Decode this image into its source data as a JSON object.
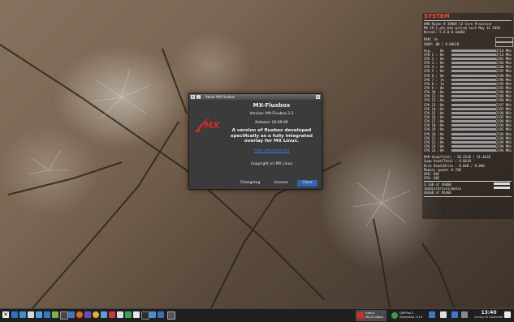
{
  "conky": {
    "title": "SYSTEM",
    "processor": "AMD Ryzen 9 3900X 12-Core Processor",
    "kernel_line": "MX-19.2_ahs_kde-gitlab test May 31 2020",
    "kernel": "Kernel: 5.6.0-0-amd64",
    "ram": "RAM:  1%",
    "swap": "SWAP:   0B  /  0.00GiB",
    "cpus": [
      {
        "label": "Avg.",
        "pct": "0%",
        "freq": "3716 MHz"
      },
      {
        "label": "CPU 1 :",
        "pct": "0%",
        "freq": "3716 MHz"
      },
      {
        "label": "CPU 2 :",
        "pct": "0%",
        "freq": "2201 MHz"
      },
      {
        "label": "CPU 3 :",
        "pct": "0%",
        "freq": "2196 MHz"
      },
      {
        "label": "CPU 4 :",
        "pct": "0%",
        "freq": "2200 MHz"
      },
      {
        "label": "CPU 5 :",
        "pct": "0%",
        "freq": "2195 MHz"
      },
      {
        "label": "CPU 6 :",
        "pct": "0%",
        "freq": "2198 MHz"
      },
      {
        "label": "CPU 7 :",
        "pct": "1%",
        "freq": "2196 MHz"
      },
      {
        "label": "CPU 8 :",
        "pct": "1%",
        "freq": "2195 MHz"
      },
      {
        "label": "CPU 9 :",
        "pct": "0%",
        "freq": "2195 MHz"
      },
      {
        "label": "CPU 10 :",
        "pct": "0%",
        "freq": "2196 MHz"
      },
      {
        "label": "CPU 11 :",
        "pct": "0%",
        "freq": "2200 MHz"
      },
      {
        "label": "CPU 12 :",
        "pct": "0%",
        "freq": "2198 MHz"
      },
      {
        "label": "CPU 13 :",
        "pct": "0%",
        "freq": "2197 MHz"
      },
      {
        "label": "CPU 14 :",
        "pct": "0%",
        "freq": "2195 MHz"
      },
      {
        "label": "CPU 15 :",
        "pct": "0%",
        "freq": "2198 MHz"
      },
      {
        "label": "CPU 16 :",
        "pct": "0%",
        "freq": "2195 MHz"
      },
      {
        "label": "CPU 17 :",
        "pct": "0%",
        "freq": "2198 MHz"
      },
      {
        "label": "CPU 18 :",
        "pct": "0%",
        "freq": "2196 MHz"
      },
      {
        "label": "CPU 19 :",
        "pct": "0%",
        "freq": "2195 MHz"
      },
      {
        "label": "CPU 20 :",
        "pct": "0%",
        "freq": "2196 MHz"
      },
      {
        "label": "CPU 21 :",
        "pct": "0%",
        "freq": "2196 MHz"
      },
      {
        "label": "CPU 22 :",
        "pct": "0%",
        "freq": "2199 MHz"
      },
      {
        "label": "CPU 23 :",
        "pct": "0%",
        "freq": "2198 MHz"
      },
      {
        "label": "CPU 24 :",
        "pct": "0%",
        "freq": "2196 MHz"
      }
    ],
    "ram_used": "RAM Used/Total : 28.2GiB / 31.4GiB",
    "swap_used": "Swap Used/Total : 0.0GiB",
    "disk_rw": "Disk Read/Write : 0.0kB / 0.0kB",
    "mem_speed": "Memory speed: 0.7GB",
    "gpu_temp": "GPU: 60C",
    "cpu_temp": "CPU: 60C",
    "disks": [
      {
        "label": "3.1GB of 468GB"
      },
      {
        "label": "/media/drive1/media"
      },
      {
        "label": "364GB of 954GB"
      }
    ]
  },
  "dialog": {
    "window_title": "About MX-Fluxbox",
    "app_name": "MX-Fluxbox",
    "version": "Version: MX-Fluxbox 2.2",
    "release": "Release: 20.09.06",
    "description_lines": [
      "A version of fluxbox developed",
      "specifically as a fully integrated",
      "overlay for MX Linux."
    ],
    "link": "http://fluxbox.org",
    "copyright": "Copyright (c) MX Linux",
    "btn_changelog": "Changelog",
    "btn_license": "License",
    "btn_close": "Close"
  },
  "taskbar": {
    "task_about_line1": "About",
    "task_about_line2": "MX-Fluxbox",
    "task_qmmp_line1": "QMPlay2 -",
    "task_qmmp_line2": "Dziejakso 3-13",
    "time": "13:40",
    "date": "Sunday 06 September"
  },
  "colors": {
    "accent": "#2d66b0",
    "conky_title": "#ff4a2f",
    "logo_red": "#d42a2a"
  }
}
